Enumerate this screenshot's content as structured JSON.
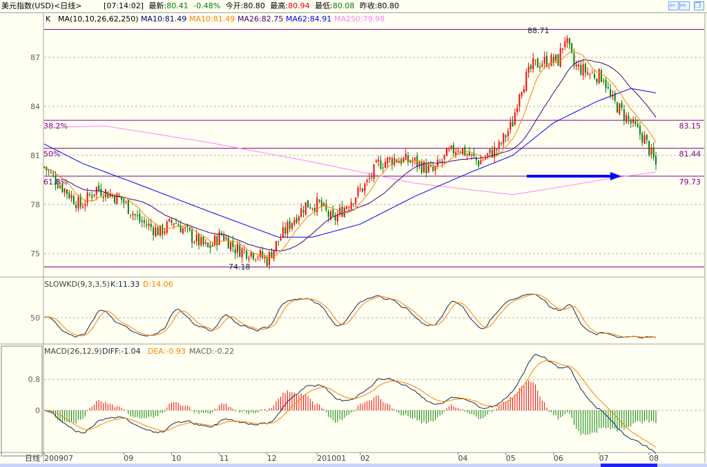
{
  "title": {
    "name": "美元指数(USD)<日线>",
    "time": "[07:14:02]",
    "latest_label": "最新:",
    "latest": "80.41",
    "change": "-0.48%",
    "open_label": "今开:",
    "open": "80.80",
    "high_label": "最高:",
    "high": "80.94",
    "low_label": "最低:",
    "low": "80.08",
    "prev_label": "昨收:",
    "prev": "80.80",
    "buttons": [
      {
        "icon": "arrow-left-icon",
        "glyph": "⇦"
      },
      {
        "icon": "arrow-right-icon",
        "glyph": "⇨"
      },
      {
        "icon": "restore-window-icon",
        "glyph": "❐"
      }
    ]
  },
  "main": {
    "k_label": "K",
    "ma_label": "MA(10,10,26,62,250)",
    "ma": [
      {
        "text": "MA10:81.49",
        "color": "#000080"
      },
      {
        "text": "MA10:81.49",
        "color": "#ff8000"
      },
      {
        "text": "MA26:82.75",
        "color": "#400080"
      },
      {
        "text": "MA62:84.91",
        "color": "#0000ff"
      },
      {
        "text": "MA250:79.98",
        "color": "#ff80ff"
      }
    ],
    "high_label": "88.71",
    "low_label": "74.18"
  },
  "colors": {
    "up": "#ff0000",
    "down": "#008000",
    "level": "#800080",
    "bg": "#fffff2",
    "arrow": "#0000ff",
    "k": "#10284a",
    "d": "#ff8000"
  },
  "chart_data": [
    {
      "type": "candlestick",
      "title": "美元指数(USD) 日线",
      "yticks": [
        87,
        84,
        81,
        78,
        75
      ],
      "ylim": [
        74.0,
        89.2
      ],
      "bars": 270,
      "close_keypoints": [
        [
          0,
          80.3
        ],
        [
          5,
          79.5
        ],
        [
          16,
          77.9
        ],
        [
          23,
          79.0
        ],
        [
          34,
          78.3
        ],
        [
          42,
          77.0
        ],
        [
          51,
          76.3
        ],
        [
          57,
          77.0
        ],
        [
          65,
          76.0
        ],
        [
          72,
          75.3
        ],
        [
          78,
          76.2
        ],
        [
          84,
          75.3
        ],
        [
          93,
          75.0
        ],
        [
          98,
          74.6
        ],
        [
          103,
          75.8
        ],
        [
          109,
          77.0
        ],
        [
          115,
          78.0
        ],
        [
          121,
          78.0
        ],
        [
          127,
          77.0
        ],
        [
          133,
          78.0
        ],
        [
          142,
          79.3
        ],
        [
          147,
          80.5
        ],
        [
          154,
          80.8
        ],
        [
          163,
          80.6
        ],
        [
          171,
          80.0
        ],
        [
          177,
          81.0
        ],
        [
          182,
          81.5
        ],
        [
          191,
          80.6
        ],
        [
          200,
          81.5
        ],
        [
          206,
          83.0
        ],
        [
          209,
          85.0
        ],
        [
          215,
          86.5
        ],
        [
          221,
          86.8
        ],
        [
          226,
          86.8
        ],
        [
          229,
          88.2
        ],
        [
          233,
          86.5
        ],
        [
          240,
          86.0
        ],
        [
          246,
          85.8
        ],
        [
          249,
          84.5
        ],
        [
          255,
          83.5
        ],
        [
          259,
          82.8
        ],
        [
          264,
          82.0
        ],
        [
          269,
          80.4
        ]
      ],
      "ma62_keypoints": [
        [
          0,
          81.7
        ],
        [
          17,
          80.5
        ],
        [
          42,
          79.2
        ],
        [
          72,
          77.6
        ],
        [
          103,
          76.0
        ],
        [
          118,
          76.0
        ],
        [
          139,
          76.8
        ],
        [
          163,
          78.5
        ],
        [
          188,
          80.0
        ],
        [
          206,
          81.0
        ],
        [
          224,
          83.0
        ],
        [
          243,
          84.3
        ],
        [
          258,
          85.1
        ],
        [
          270,
          84.8
        ]
      ],
      "ma250_keypoints": [
        [
          0,
          82.7
        ],
        [
          27,
          82.8
        ],
        [
          72,
          81.8
        ],
        [
          118,
          80.6
        ],
        [
          163,
          79.3
        ],
        [
          206,
          78.6
        ],
        [
          224,
          79.0
        ],
        [
          249,
          79.6
        ],
        [
          270,
          80.0
        ]
      ],
      "levels": [
        {
          "value": 88.71,
          "label": ""
        },
        {
          "value": 83.15,
          "label": "83.15",
          "fib": "38.2%"
        },
        {
          "value": 81.44,
          "label": "81.44",
          "fib": "50%"
        },
        {
          "value": 79.73,
          "label": "79.73",
          "fib": "61.8%"
        },
        {
          "value": 74.18,
          "label": ""
        }
      ]
    },
    {
      "type": "line",
      "title": "SLOWKD(9,3,3,5)",
      "k_text": "K:11.33",
      "d_text": "D:14.06",
      "yticks": [
        50
      ],
      "ylim": [
        0,
        100
      ]
    },
    {
      "type": "bar+line",
      "title": "MACD(26,12,9)",
      "diff_text": "DIFF:-1.04",
      "dea_text": "DEA:-0.93",
      "macd_text": "MACD:-0.22",
      "yticks": [
        0.8,
        0
      ],
      "ylim": [
        -1.1,
        1.4
      ]
    }
  ],
  "kd": {
    "label": "SLOWKD(9,3,3,5)",
    "k": "K:11.33",
    "d": "D:14.06",
    "tick": "50"
  },
  "macd": {
    "label": "MACD(26,12,9)",
    "diff": "DIFF:-1.04",
    "dea": "DEA:-0.93",
    "macd": "MACD:-0.22",
    "ticks": [
      "0.8",
      "0"
    ]
  },
  "xaxis": {
    "period": "日线",
    "labels": [
      [
        "200907",
        0
      ],
      [
        "09",
        35
      ],
      [
        "10",
        56
      ],
      [
        "11",
        77
      ],
      [
        "12",
        98
      ],
      [
        "201001",
        120
      ],
      [
        "02",
        139
      ],
      [
        "04",
        182
      ],
      [
        "05",
        203
      ],
      [
        "06",
        224
      ],
      [
        "07",
        244
      ],
      [
        "08",
        266
      ]
    ]
  }
}
